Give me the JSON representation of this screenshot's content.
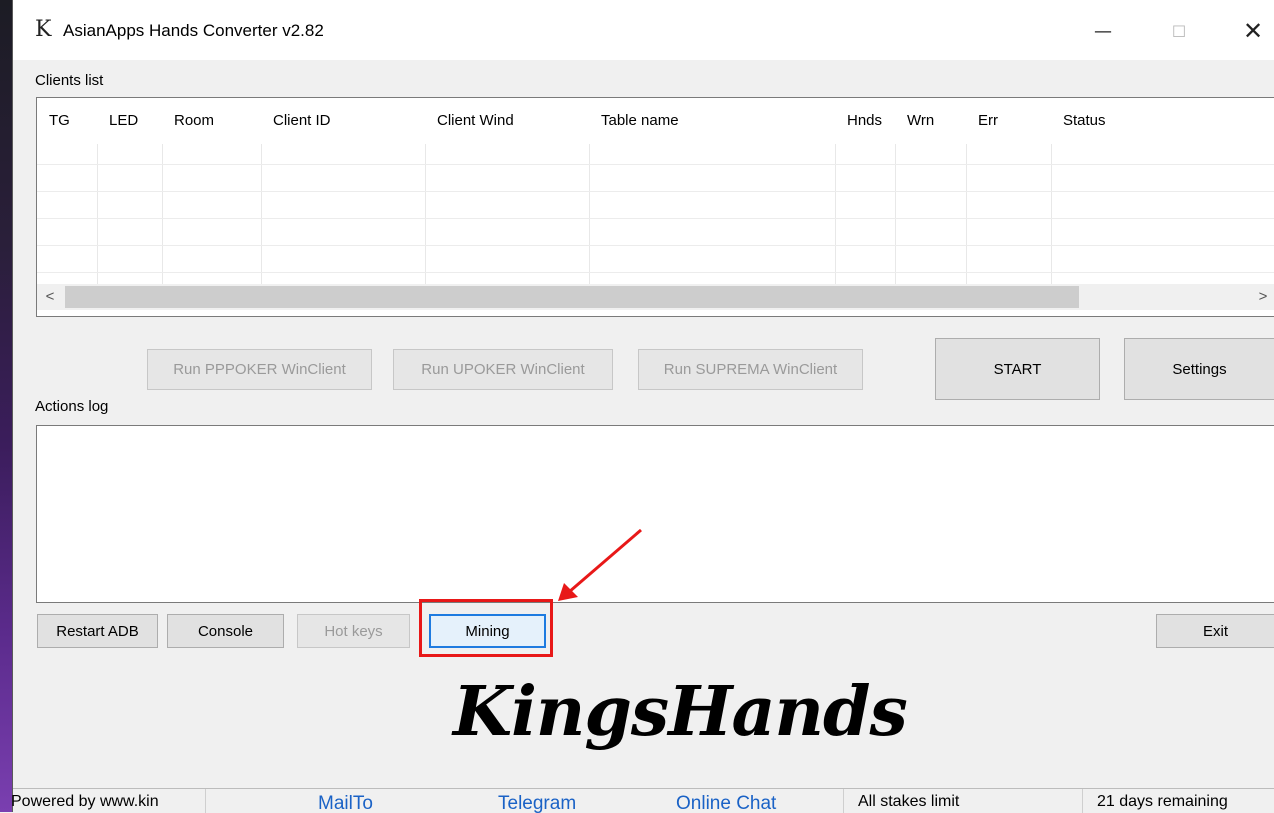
{
  "window": {
    "title": "AsianApps Hands Converter v2.82",
    "app_icon": "K",
    "controls": {
      "minimize": "—",
      "maximize": "☐",
      "close": "✕"
    }
  },
  "clients_list": {
    "label": "Clients list",
    "columns": [
      "TG",
      "LED",
      "Room",
      "Client ID",
      "Client Wind",
      "Table name",
      "Hnds",
      "Wrn",
      "Err",
      "Status"
    ],
    "rows": []
  },
  "run_buttons": {
    "pppoker": "Run PPPOKER WinClient",
    "upoker": "Run UPOKER WinClient",
    "suprema": "Run SUPREMA WinClient"
  },
  "main_buttons": {
    "start": "START",
    "settings": "Settings"
  },
  "actions_log": {
    "label": "Actions log",
    "entries": []
  },
  "bottom_buttons": {
    "restart_adb": "Restart ADB",
    "console": "Console",
    "hot_keys": "Hot keys",
    "mining": "Mining",
    "exit": "Exit"
  },
  "logo": {
    "text": "KingsHands"
  },
  "status_bar": {
    "powered_by": "Powered by www.kin",
    "mailto": "MailTo",
    "telegram": "Telegram",
    "online_chat": "Online Chat",
    "stakes": "All stakes limit",
    "remaining": "21 days remaining"
  },
  "annotation": {
    "highlight_color": "#e81818"
  },
  "colors": {
    "link": "#1a62c6",
    "focus": "#1e7be0"
  }
}
